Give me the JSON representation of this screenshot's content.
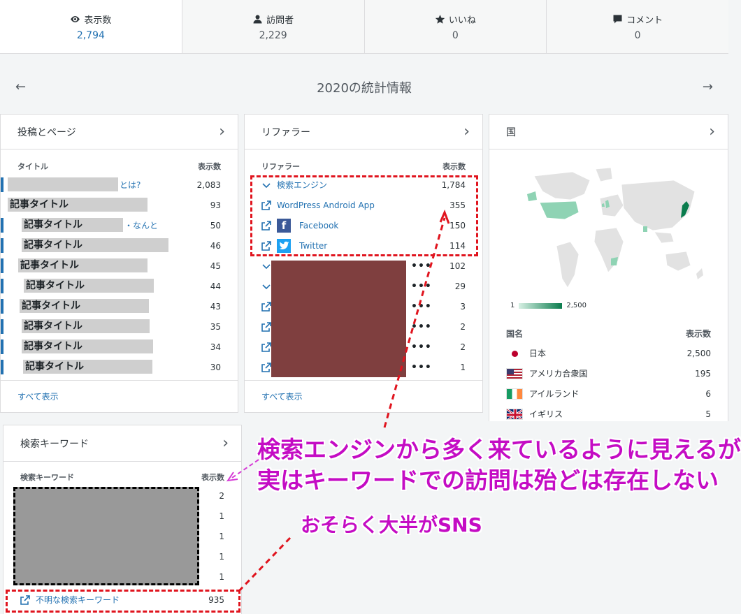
{
  "stats": [
    {
      "label": "表示数",
      "value": "2,794",
      "icon": "eye-icon"
    },
    {
      "label": "訪問者",
      "value": "2,229",
      "icon": "person-icon"
    },
    {
      "label": "いいね",
      "value": "0",
      "icon": "star-icon"
    },
    {
      "label": "コメント",
      "value": "0",
      "icon": "comment-icon"
    }
  ],
  "year_nav": {
    "title": "2020の統計情報",
    "prev": "←",
    "next": "→"
  },
  "posts": {
    "title": "投稿とページ",
    "col_title": "タイトル",
    "col_views": "表示数",
    "rows": [
      {
        "text": "",
        "suffix": "とは?",
        "views": "2,083"
      },
      {
        "text": "記事タイトル",
        "suffix": "",
        "views": "93"
      },
      {
        "text": "記事タイトル",
        "suffix": "・なんと",
        "views": "50"
      },
      {
        "text": "記事タイトル",
        "suffix": "",
        "views": "46"
      },
      {
        "text": "記事タイトル",
        "suffix": "",
        "views": "45"
      },
      {
        "text": "記事タイトル",
        "suffix": "",
        "views": "44"
      },
      {
        "text": "記事タイトル",
        "suffix": "",
        "views": "43"
      },
      {
        "text": "記事タイトル",
        "suffix": "",
        "views": "35"
      },
      {
        "text": "記事タイトル",
        "suffix": "",
        "views": "34"
      },
      {
        "text": "記事タイトル",
        "suffix": "",
        "views": "30"
      }
    ],
    "footer": "すべて表示"
  },
  "referrers": {
    "title": "リファラー",
    "col_name": "リファラー",
    "col_views": "表示数",
    "rows": [
      {
        "name": "検索エンジン",
        "views": "1,784",
        "icon": "chevron-down-icon"
      },
      {
        "name": "WordPress Android App",
        "views": "355",
        "icon": "external-link-icon"
      },
      {
        "name": "Facebook",
        "views": "150",
        "icon": "external-link-icon"
      },
      {
        "name": "Twitter",
        "views": "114",
        "icon": "external-link-icon"
      }
    ],
    "hidden_rows": [
      {
        "views": "102",
        "dots": "•••"
      },
      {
        "views": "29",
        "dots": "•••"
      },
      {
        "views": "3",
        "dots": "•••"
      },
      {
        "views": "2",
        "dots": "•••"
      },
      {
        "views": "2",
        "dots": "•••"
      },
      {
        "views": "1",
        "dots": "•••"
      }
    ],
    "footer": "すべて表示"
  },
  "countries": {
    "title": "国",
    "legend_min": "1",
    "legend_max": "2,500",
    "col_name": "国名",
    "col_views": "表示数",
    "rows": [
      {
        "name": "日本",
        "views": "2,500"
      },
      {
        "name": "アメリカ合衆国",
        "views": "195"
      },
      {
        "name": "アイルランド",
        "views": "6"
      },
      {
        "name": "イギリス",
        "views": "5"
      }
    ]
  },
  "keywords": {
    "title": "検索キーワード",
    "col_name": "検索キーワード",
    "col_views": "表示数",
    "rows": [
      "2",
      "1",
      "1",
      "1",
      "1"
    ],
    "unknown_label": "不明な検索キーワード",
    "unknown_views": "935"
  },
  "annotations": {
    "line1": "検索エンジンから多く来ているように見えるが",
    "line2": "実はキーワードでの訪問は殆どは存在しない",
    "line3": "おそらく大半がSNS",
    "color": "#c40cc4",
    "dash_color": "#e0141e"
  }
}
